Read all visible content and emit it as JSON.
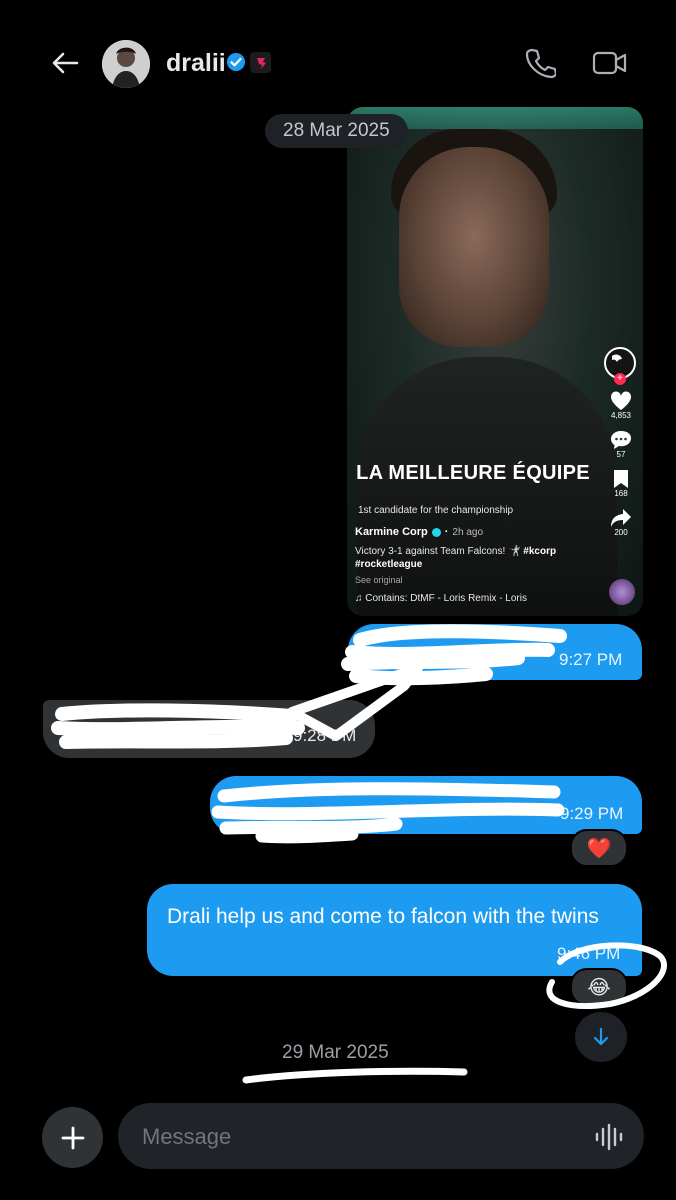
{
  "header": {
    "username": "dralii",
    "back_icon": "arrow-left-icon",
    "verified_icon": "verified-badge-icon",
    "affiliation_icon": "affiliate-logo-icon",
    "call_icon": "phone-icon",
    "video_icon": "video-camera-icon"
  },
  "dates": {
    "first": "28 Mar 2025",
    "second": "29 Mar 2025"
  },
  "shared_video": {
    "headline": "LA MEILLEURE ÉQUIPE",
    "caption": "1st candidate for the championship",
    "author": "Karmine Corp",
    "posted": "2h ago",
    "description": "Victory 3-1 against Team Falcons! 🤺",
    "hashtag1": "#kcorp",
    "hashtag2": "#rocketleague",
    "see_original": "See original",
    "music": "♫ Contains: DtMF - Loris Remix - Loris",
    "likes": "4,853",
    "comments": "57",
    "saves": "168",
    "shares": "200"
  },
  "messages": [
    {
      "direction": "out",
      "text": "",
      "time": "9:27 PM"
    },
    {
      "direction": "in",
      "text": "",
      "time": "9:28 PM"
    },
    {
      "direction": "out",
      "text": "",
      "time": "9:29 PM",
      "reaction": "❤️"
    },
    {
      "direction": "out",
      "text": "Drali help us and come to falcon with the twins",
      "time": "9:46 PM",
      "reaction": "😂"
    }
  ],
  "composer": {
    "placeholder": "Message",
    "add_icon": "plus-icon",
    "voice_icon": "waveform-icon"
  },
  "colors": {
    "accent": "#1d9bf0",
    "incoming": "#2f3336",
    "background": "#000000"
  }
}
